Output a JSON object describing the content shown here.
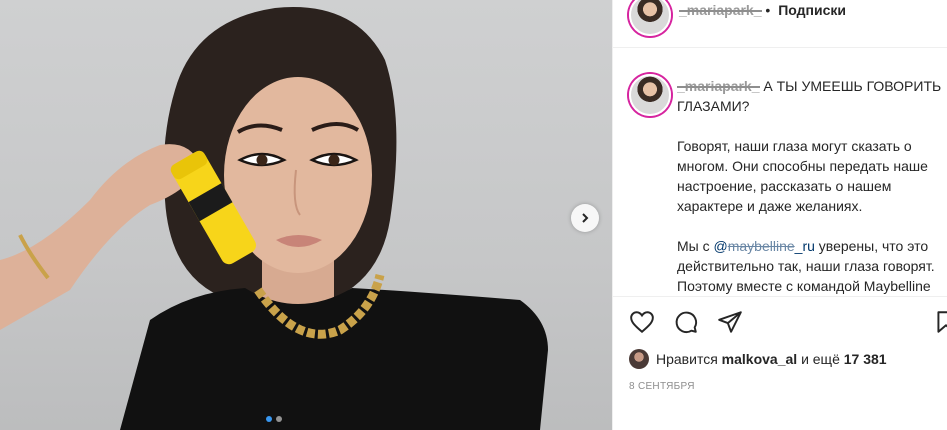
{
  "post": {
    "media": {
      "description": "Фото: женщина держит жёлтую тушь",
      "slide_index": 1,
      "slide_count": 2
    },
    "header": {
      "username": "_mariapark_",
      "separator": "•",
      "follow_label": "Подписки"
    },
    "caption": {
      "username": "_mariapark_",
      "headline": "А ТЫ УМЕЕШЬ ГОВОРИТЬ ГЛАЗАМИ?",
      "paragraph1": "Говорят, наши глаза могут сказать о многом. Они способны передать наше настроение, рассказать о нашем характере и даже желаниях.",
      "paragraph2_prefix": "Мы с ",
      "mention_at": "@",
      "mention_struck": "maybelline",
      "mention_tail": "_ru",
      "paragraph2_suffix": " уверены, что это действительно так, наши глаза говорят. Поэтому вместе с командой Maybelline NY"
    },
    "likes": {
      "prefix": "Нравится",
      "user": "malkova_al",
      "middle": "и ещё",
      "count": "17 381"
    },
    "date": "8 СЕНТЯБРЯ"
  },
  "icons": {
    "like": "heart-icon",
    "comment": "comment-icon",
    "share": "share-icon",
    "save": "bookmark-icon",
    "next": "chevron-right-icon"
  },
  "colors": {
    "accent": "#3897f0",
    "text": "#262626",
    "muted": "#8e8e8e",
    "link": "#00376b",
    "story_ring": "#d6249f"
  }
}
